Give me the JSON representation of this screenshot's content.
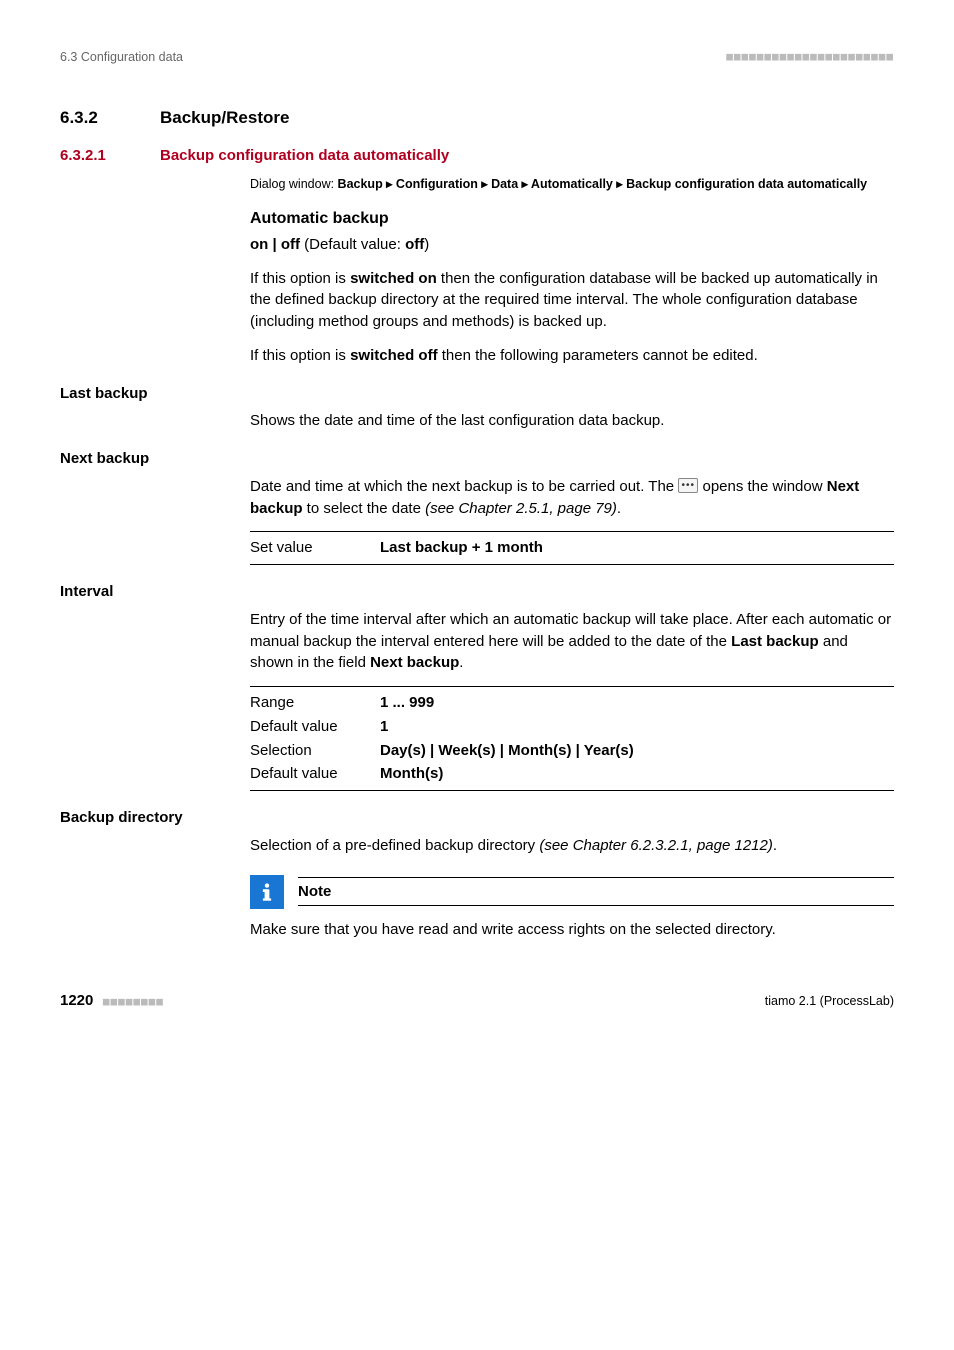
{
  "header": {
    "breadcrumb": "6.3 Configuration data"
  },
  "s632": {
    "num": "6.3.2",
    "title": "Backup/Restore"
  },
  "s6321": {
    "num": "6.3.2.1",
    "title": "Backup configuration data automatically",
    "dialog_prefix": "Dialog window: ",
    "dialog_path": "Backup ▸ Configuration ▸ Data ▸ Automatically ▸ Backup configuration data automatically",
    "auto_backup_heading": "Automatic backup",
    "onoff_a": "on | off",
    "onoff_b": " (Default value: ",
    "onoff_c": "off",
    "onoff_d": ")",
    "p1a": "If this option is ",
    "p1b": "switched on",
    "p1c": " then the configuration database will be backed up automatically in the defined backup directory at the required time interval. The whole configuration database (including method groups and methods) is backed up.",
    "p2a": "If this option is ",
    "p2b": "switched off",
    "p2c": " then the following parameters cannot be edited."
  },
  "last_backup": {
    "label": "Last backup",
    "text": "Shows the date and time of the last configuration data backup."
  },
  "next_backup": {
    "label": "Next backup",
    "t1": "Date and time at which the next backup is to be carried out. The ",
    "t2": " opens the window ",
    "t3": "Next backup",
    "t4": " to select the date ",
    "t5": "(see Chapter 2.5.1, page 79)",
    "t6": ".",
    "kv_key": "Set value",
    "kv_val": "Last backup  + 1 month"
  },
  "interval": {
    "label": "Interval",
    "t1": "Entry of the time interval after which an automatic backup will take place. After each automatic or manual backup the interval entered here will be added to the date of the ",
    "t2": "Last backup",
    "t3": " and shown in the field ",
    "t4": "Next backup",
    "t5": ".",
    "rows": {
      "range_k": "Range",
      "range_v": "1 ... 999",
      "def1_k": "Default value",
      "def1_v": "1",
      "sel_k": "Selection",
      "sel_v": "Day(s) | Week(s) | Month(s) | Year(s)",
      "def2_k": "Default value",
      "def2_v": "Month(s)"
    }
  },
  "backup_dir": {
    "label": "Backup directory",
    "t1": "Selection of a pre-defined backup directory ",
    "t2": "(see Chapter 6.2.3.2.1, page 1212)",
    "t3": "."
  },
  "note": {
    "title": "Note",
    "text": "Make sure that you have read and write access rights on the selected directory."
  },
  "footer": {
    "page": "1220",
    "product": "tiamo 2.1 (ProcessLab)"
  }
}
